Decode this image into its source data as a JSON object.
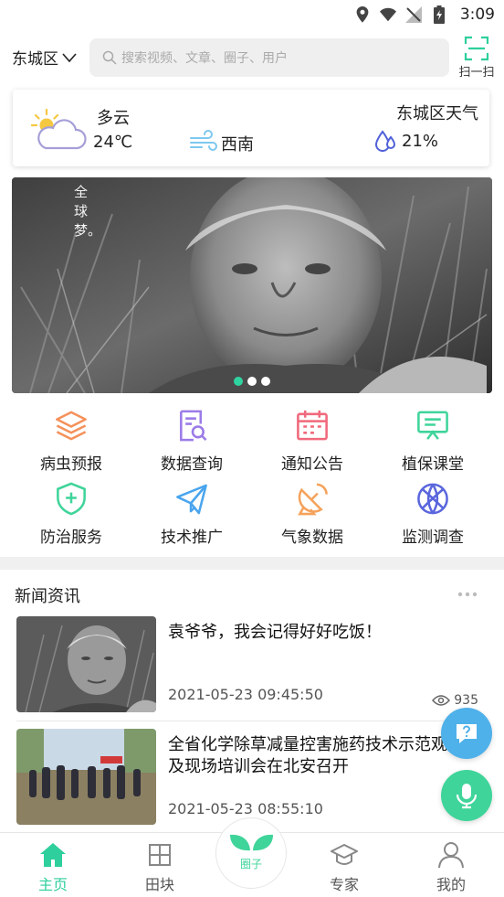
{
  "status_bar": {
    "time": "3:09",
    "icons": [
      "location-icon",
      "wifi-icon",
      "signal-off-icon",
      "battery-icon"
    ]
  },
  "header": {
    "location": "东城区",
    "search_placeholder": "搜索视频、文章、圈子、用户",
    "scan_label": "扫一扫"
  },
  "weather": {
    "condition": "多云",
    "temperature": "24℃",
    "wind": "西南",
    "city_label": "东城区天气",
    "humidity": "21%"
  },
  "banner": {
    "caption": "全球梦。",
    "slide_count": 3,
    "active_slide": 1
  },
  "menu": [
    {
      "label": "病虫预报",
      "icon": "layers-icon",
      "color": "#f5915a"
    },
    {
      "label": "数据查询",
      "icon": "document-search-icon",
      "color": "#9b7be8"
    },
    {
      "label": "通知公告",
      "icon": "calendar-icon",
      "color": "#f0697c"
    },
    {
      "label": "植保课堂",
      "icon": "presentation-icon",
      "color": "#3fd49a"
    },
    {
      "label": "防治服务",
      "icon": "shield-plus-icon",
      "color": "#3fd49a"
    },
    {
      "label": "技术推广",
      "icon": "paper-plane-icon",
      "color": "#4aa5ee"
    },
    {
      "label": "气象数据",
      "icon": "satellite-dish-icon",
      "color": "#f5a25a"
    },
    {
      "label": "监测调查",
      "icon": "globe-icon",
      "color": "#5a66dd"
    }
  ],
  "news": {
    "section_title": "新闻资讯",
    "items": [
      {
        "title": "袁爷爷，我会记得好好吃饭！",
        "date": "2021-05-23 09:45:50",
        "views": "935"
      },
      {
        "title": "全省化学除草减量控害施药技术示范观摩及现场培训会在北安召开",
        "date": "2021-05-23 08:55:10",
        "views": ""
      }
    ]
  },
  "bottom_nav": [
    {
      "label": "主页",
      "icon": "home-icon",
      "active": true
    },
    {
      "label": "田块",
      "icon": "field-icon",
      "active": false
    },
    {
      "label": "专家",
      "icon": "graduation-cap-icon",
      "active": false
    },
    {
      "label": "我的",
      "icon": "user-icon",
      "active": false
    }
  ],
  "center_button_text": "圈子",
  "colors": {
    "accent": "#2ecf9c",
    "help_button": "#4fb1ea",
    "voice_button": "#3fd49a"
  }
}
